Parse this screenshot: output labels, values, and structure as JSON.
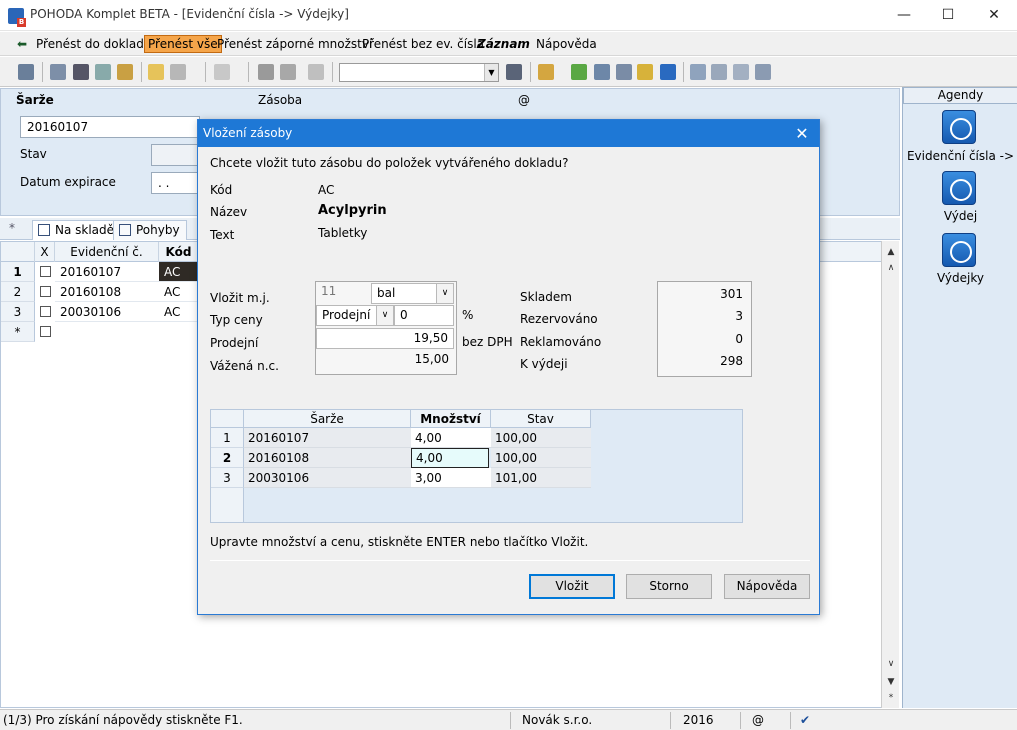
{
  "window": {
    "title": "POHODA Komplet BETA - [Evidenční čísla -> Výdejky]",
    "minimize_glyph": "—",
    "maximize_glyph": "☐",
    "close_glyph": "✕"
  },
  "menu": {
    "back_glyph": "⬅",
    "items": [
      "Přenést do dokladu",
      "Přenést vše",
      "Přenést záporné množství",
      "Přenést bez ev. čísla",
      "Záznam",
      "Nápověda"
    ]
  },
  "form": {
    "sarze_label": "Šarže",
    "sarze_value": "20160107",
    "zasoba_label": "Zásoba",
    "at_label": "@",
    "stav_label": "Stav",
    "datum_expirace_label": "Datum expirace",
    "datum_expirace_value": ". ."
  },
  "tabs": [
    {
      "label": "Na skladě"
    },
    {
      "label": "Pohyby"
    }
  ],
  "background_grid": {
    "headers": [
      "X",
      "Evidenční č.",
      "Kód"
    ],
    "new_row_marker": "*",
    "rows": [
      {
        "no": "1",
        "evidencni": "20160107",
        "kod": "AC"
      },
      {
        "no": "2",
        "evidencni": "20160108",
        "kod": "AC"
      },
      {
        "no": "3",
        "evidencni": "20030106",
        "kod": "AC"
      }
    ]
  },
  "agendy": {
    "title": "Agendy",
    "items": [
      "Evidenční čísla ->",
      "Výdej",
      "Výdejky"
    ]
  },
  "statusbar": {
    "help": "(1/3) Pro získání nápovědy stiskněte F1.",
    "company": "Novák s.r.o.",
    "year": "2016",
    "at": "@",
    "check": "✔"
  },
  "dialog": {
    "title": "Vložení zásoby",
    "close_glyph": "✕",
    "question": "Chcete vložit tuto zásobu do položek vytvářeného dokladu?",
    "kod_label": "Kód",
    "kod_value": "AC",
    "nazev_label": "Název",
    "nazev_value": "Acylpyrin",
    "text_label": "Text",
    "text_value": "Tabletky",
    "vlozit_mj_label": "Vložit m.j.",
    "mj_count": "11",
    "mj_unit": "bal",
    "typ_ceny_label": "Typ ceny",
    "typ_ceny_value": "Prodejní",
    "discount_value": "0",
    "percent_label": "%",
    "prodejni_label": "Prodejní",
    "prodejni_value": "19,50",
    "bez_dph_label": "bez DPH",
    "vazena_label": "Vážená n.c.",
    "vazena_value": "15,00",
    "skladem_label": "Skladem",
    "skladem_value": "301",
    "rezervovano_label": "Rezervováno",
    "rezervovano_value": "3",
    "reklamovano_label": "Reklamováno",
    "reklamovano_value": "0",
    "k_vydeji_label": "K výdeji",
    "k_vydeji_value": "298",
    "grid": {
      "headers": [
        "Šarže",
        "Množství",
        "Stav"
      ],
      "rows": [
        {
          "no": "1",
          "sarze": "20160107",
          "mnozstvi": "4,00",
          "stav": "100,00"
        },
        {
          "no": "2",
          "sarze": "20160108",
          "mnozstvi": "4,00",
          "stav": "100,00"
        },
        {
          "no": "3",
          "sarze": "20030106",
          "mnozstvi": "3,00",
          "stav": "101,00"
        }
      ]
    },
    "hint": "Upravte množství a cenu, stiskněte ENTER nebo tlačítko Vložit.",
    "buttons": {
      "vlozit": "Vložit",
      "storno": "Storno",
      "napoveda": "Nápověda"
    }
  }
}
